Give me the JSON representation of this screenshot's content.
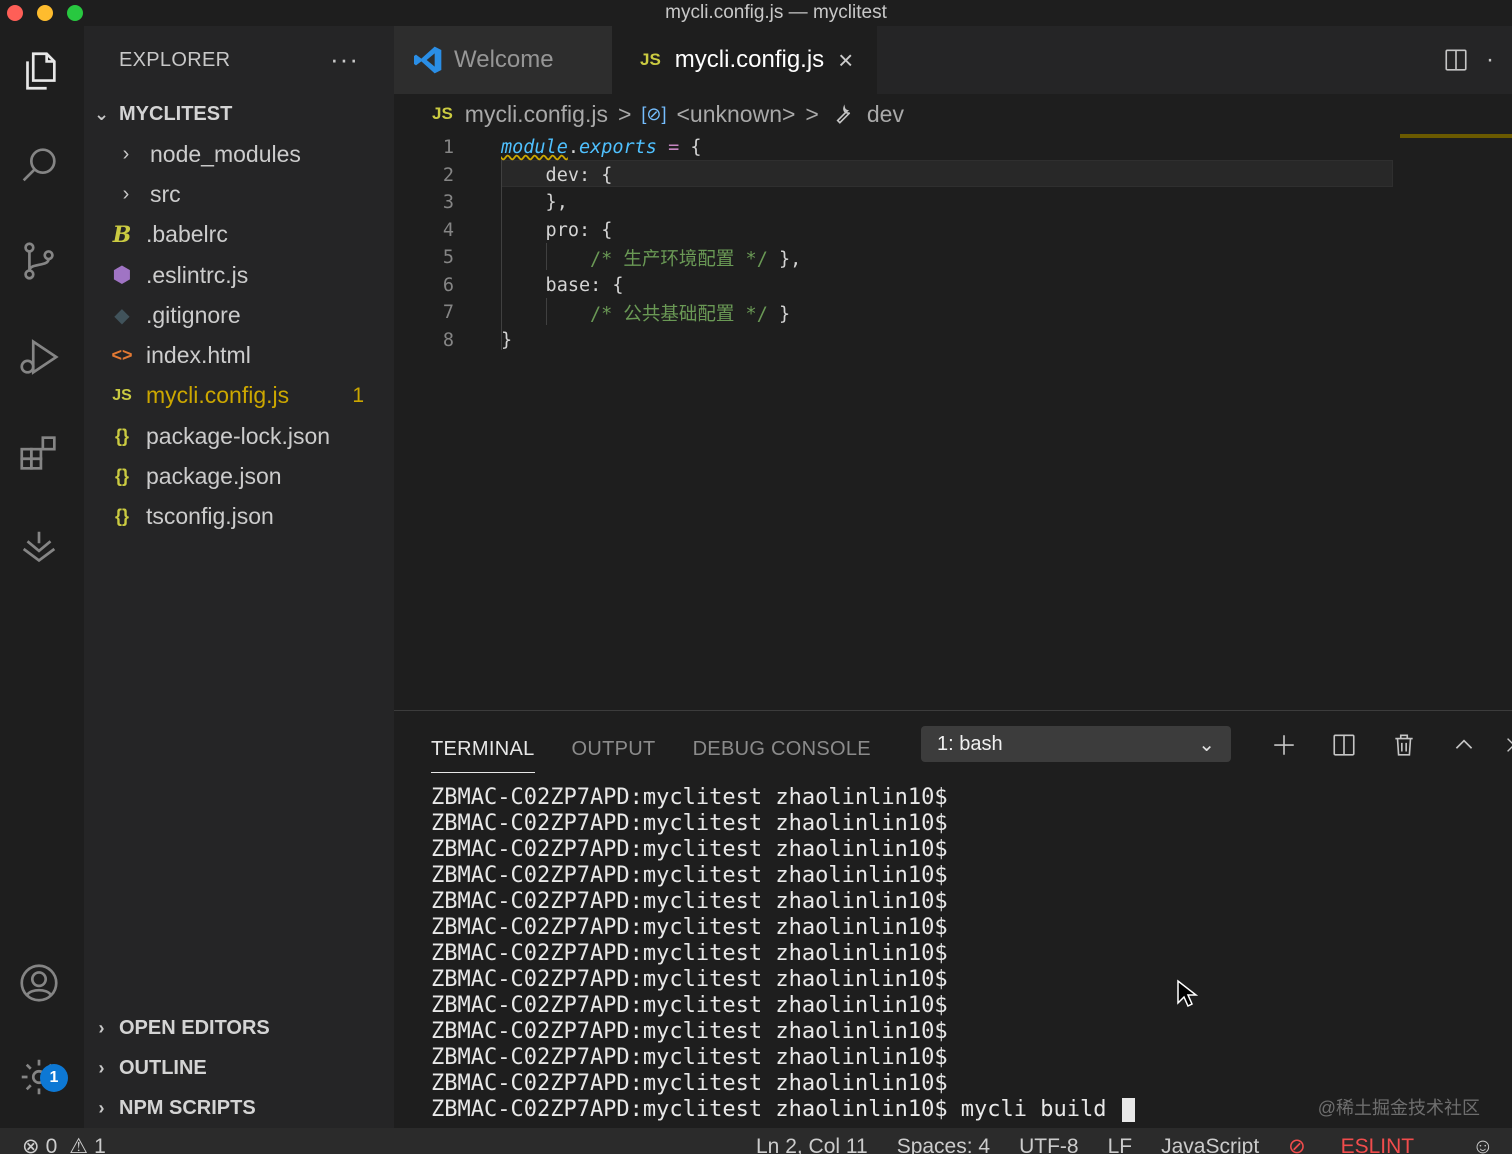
{
  "window": {
    "title": "mycli.config.js — myclitest"
  },
  "activity_bar": {
    "items": [
      "explorer-icon",
      "search-icon",
      "source-control-icon",
      "run-debug-icon",
      "extensions-icon",
      "npm-icon"
    ],
    "bottom": [
      "account-icon",
      "settings-gear-icon"
    ],
    "settings_badge": "1"
  },
  "sidebar": {
    "header": "EXPLORER",
    "more": "···",
    "folder": "MYCLITEST",
    "items": [
      {
        "label": "node_modules",
        "icon": "chevron-right",
        "type": "folder"
      },
      {
        "label": "src",
        "icon": "chevron-right",
        "type": "folder"
      },
      {
        "label": ".babelrc",
        "icon": "babel-icon",
        "type": "file"
      },
      {
        "label": ".eslintrc.js",
        "icon": "eslint-icon",
        "type": "file"
      },
      {
        "label": ".gitignore",
        "icon": "git-icon",
        "type": "file"
      },
      {
        "label": "index.html",
        "icon": "html-icon",
        "type": "file"
      },
      {
        "label": "mycli.config.js",
        "icon": "js-icon",
        "type": "file",
        "count": "1"
      },
      {
        "label": "package-lock.json",
        "icon": "json-icon",
        "type": "file"
      },
      {
        "label": "package.json",
        "icon": "json-icon",
        "type": "file"
      },
      {
        "label": "tsconfig.json",
        "icon": "json-icon",
        "type": "file"
      }
    ],
    "sections": [
      "OPEN EDITORS",
      "OUTLINE",
      "NPM SCRIPTS"
    ]
  },
  "tabs": [
    {
      "label": "Welcome",
      "icon": "vscode-icon"
    },
    {
      "label": "mycli.config.js",
      "icon_text": "JS",
      "close": "×"
    }
  ],
  "breadcrumb": {
    "file": "mycli.config.js",
    "file_icon": "JS",
    "symbol1": "<unknown>",
    "symbol2": "dev",
    "sep": ">"
  },
  "editor": {
    "lines": [
      {
        "n": "1"
      },
      {
        "n": "2",
        "text": "    dev: {"
      },
      {
        "n": "3",
        "text": "    },"
      },
      {
        "n": "4",
        "text": "    pro: {"
      },
      {
        "n": "5",
        "comment": "/* 生产环境配置 */",
        "tail": " },"
      },
      {
        "n": "6",
        "text": "    base: {"
      },
      {
        "n": "7",
        "comment": "/* 公共基础配置 */",
        "tail": " }"
      },
      {
        "n": "8",
        "text": "}"
      }
    ],
    "line1": {
      "module": "module",
      "dot": ".",
      "exports": "exports",
      "eq": " = ",
      "brace": "{"
    }
  },
  "panel": {
    "tabs": [
      "TERMINAL",
      "OUTPUT",
      "DEBUG CONSOLE"
    ],
    "terminal_select": "1: bash",
    "prompt": "ZBMAC-C02ZP7APD:myclitest zhaolinlin10$",
    "prompt_count": 13,
    "last_command": " mycli build ",
    "watermark": "@稀土掘金技术社区"
  },
  "status_bar": {
    "errors": "0",
    "warnings": "1",
    "position": "Ln 2, Col 11",
    "spaces": "Spaces: 4",
    "encoding": "UTF-8",
    "eol": "LF",
    "language": "JavaScript",
    "eslint": "ESLINT"
  },
  "colors": {
    "accent": "#0d78d4",
    "js_yellow": "#cbcb41",
    "modified": "#cca700",
    "eslint_error": "#f14c4c"
  }
}
